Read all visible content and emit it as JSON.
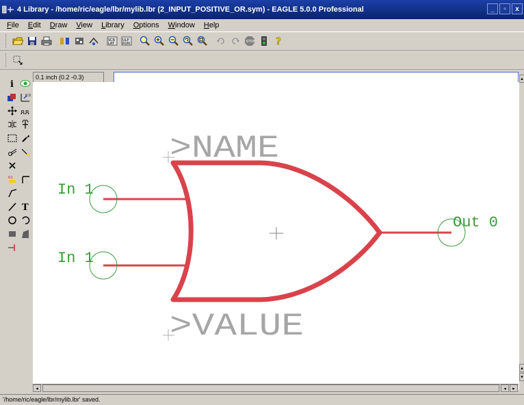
{
  "window": {
    "title": "4 Library - /home/ric/eagle/lbr/mylib.lbr (2_INPUT_POSITIVE_OR.sym) - EAGLE 5.0.0 Professional",
    "buttons": [
      "_",
      "▫",
      "x"
    ]
  },
  "menu": {
    "items": [
      {
        "label": "File",
        "underline": "F",
        "rest": "ile"
      },
      {
        "label": "Edit",
        "underline": "E",
        "rest": "dit"
      },
      {
        "label": "Draw",
        "underline": "D",
        "rest": "raw"
      },
      {
        "label": "View",
        "underline": "V",
        "rest": "iew"
      },
      {
        "label": "Library",
        "underline": "L",
        "rest": "ibrary"
      },
      {
        "label": "Options",
        "underline": "O",
        "rest": "ptions"
      },
      {
        "label": "Window",
        "underline": "W",
        "rest": "indow"
      },
      {
        "label": "Help",
        "underline": "H",
        "rest": "elp"
      }
    ]
  },
  "coordinates": {
    "readout": "0.1 inch (0.2 -0.3)"
  },
  "command_line": {
    "value": ""
  },
  "schematic": {
    "name_label": ">NAME",
    "value_label": ">VALUE",
    "input_pins": [
      "In 1",
      "In 1"
    ],
    "output_pin": "Out 0"
  },
  "status": {
    "message": "'/home/ric/eagle/lbr/mylib.lbr' saved."
  },
  "colors": {
    "gate": "#d9434b",
    "pin": "#3a9a3a",
    "text": "#a0a0a0",
    "titlebar": "#0a246a"
  }
}
